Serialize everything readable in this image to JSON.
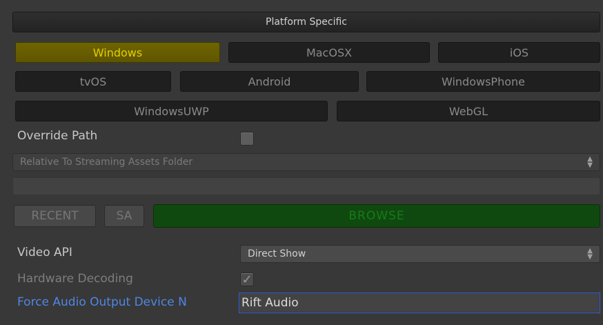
{
  "header": {
    "title": "Platform Specific"
  },
  "platform_tabs": [
    {
      "label": "Windows",
      "active": true
    },
    {
      "label": "MacOSX",
      "active": false
    },
    {
      "label": "iOS",
      "active": false
    },
    {
      "label": "tvOS",
      "active": false
    },
    {
      "label": "Android",
      "active": false
    },
    {
      "label": "WindowsPhone",
      "active": false
    },
    {
      "label": "WindowsUWP",
      "active": false
    },
    {
      "label": "WebGL",
      "active": false
    }
  ],
  "override_path": {
    "label": "Override Path",
    "checked": false
  },
  "path_mode": {
    "value": "Relative To Streaming Assets Folder"
  },
  "path_field": {
    "value": ""
  },
  "buttons": {
    "recent": "RECENT",
    "sa": "SA",
    "browse": "BROWSE"
  },
  "video_api": {
    "label": "Video API",
    "value": "Direct Show"
  },
  "hardware_decoding": {
    "label": "Hardware Decoding",
    "checked": true,
    "check_glyph": "✓"
  },
  "force_audio": {
    "label": "Force Audio Output Device N",
    "value": "Rift Audio"
  },
  "colors": {
    "active_tab": "#6f6400",
    "browse": "#0f4910",
    "focus_label": "#4f86e6"
  }
}
